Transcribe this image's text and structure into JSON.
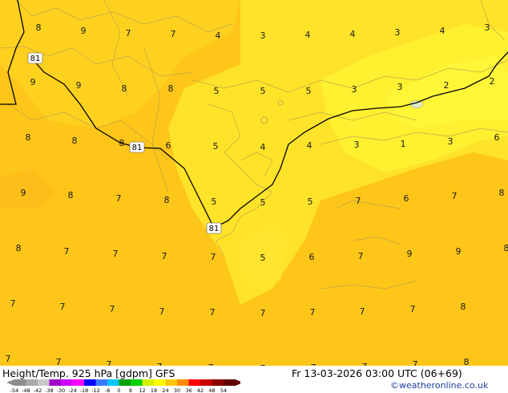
{
  "map": {
    "contour_value": "81",
    "contour_labels": [
      "81",
      "81",
      "81"
    ],
    "temperature_values": [
      "8",
      "9",
      "7",
      "7",
      "4",
      "3",
      "4",
      "4",
      "3",
      "4",
      "3",
      "9",
      "9",
      "8",
      "8",
      "5",
      "5",
      "5",
      "3",
      "3",
      "2",
      "2",
      "8",
      "8",
      "8",
      "6",
      "5",
      "4",
      "4",
      "3",
      "1",
      "3",
      "6",
      "9",
      "8",
      "7",
      "8",
      "5",
      "5",
      "5",
      "7",
      "6",
      "7",
      "8",
      "8",
      "7",
      "7",
      "7",
      "7",
      "5",
      "6",
      "7",
      "9",
      "9",
      "8",
      "7",
      "7",
      "7",
      "7",
      "7",
      "7",
      "7",
      "7",
      "7",
      "8",
      "7",
      "7",
      "7",
      "7",
      "7",
      "7",
      "7",
      "7",
      "7",
      "8"
    ],
    "colors": {
      "background": "#ffc61a",
      "warm_zone": "#ffd11f",
      "cool_zone": "#fff030",
      "coast": "#b8a14a",
      "contour": "#000000"
    }
  },
  "footer": {
    "title": "Height/Temp. 925 hPa [gdpm] GFS",
    "datetime": "Fr 13-03-2026 03:00 UTC (06+69)",
    "copyright": "©weatheronline.co.uk"
  },
  "scale": {
    "labels": [
      "-54",
      "-48",
      "-42",
      "-38",
      "-30",
      "-24",
      "-18",
      "-12",
      "-8",
      "0",
      "8",
      "12",
      "18",
      "24",
      "30",
      "36",
      "42",
      "48",
      "54"
    ],
    "colors": [
      "#8c8c8c",
      "#a9a9a9",
      "#c9c9c9",
      "#a000c8",
      "#d000ff",
      "#ff00ff",
      "#0000ff",
      "#3c78ff",
      "#00c8ff",
      "#00a000",
      "#00d000",
      "#d2f000",
      "#ffff00",
      "#ffc800",
      "#ff8c00",
      "#ff0000",
      "#c80000",
      "#8b0000",
      "#640000"
    ]
  }
}
